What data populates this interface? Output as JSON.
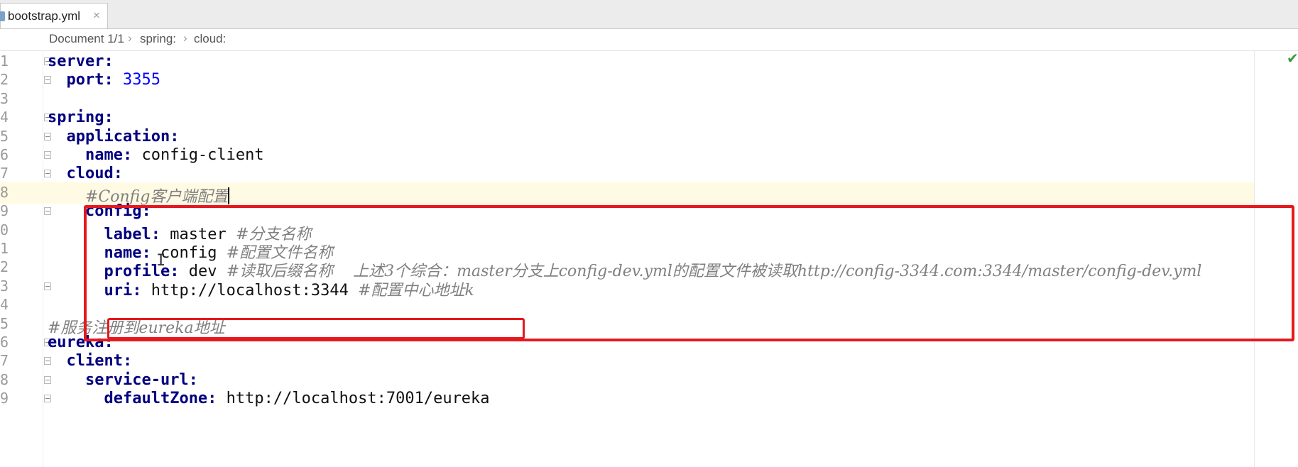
{
  "tab": {
    "label": "bootstrap.yml",
    "close": "×"
  },
  "breadcrumb": {
    "items": [
      "Document 1/1",
      "spring:",
      "cloud:"
    ],
    "separator": "›"
  },
  "status_check": "✔",
  "lines": [
    {
      "num": "1",
      "parts": [
        {
          "t": "key",
          "v": "server:"
        }
      ]
    },
    {
      "num": "2",
      "parts": [
        {
          "t": "ws",
          "v": "  "
        },
        {
          "t": "key",
          "v": "port:"
        },
        {
          "t": "val",
          "v": " "
        },
        {
          "t": "num",
          "v": "3355"
        }
      ]
    },
    {
      "num": "3",
      "parts": []
    },
    {
      "num": "4",
      "parts": [
        {
          "t": "key",
          "v": "spring:"
        }
      ]
    },
    {
      "num": "5",
      "parts": [
        {
          "t": "ws",
          "v": "  "
        },
        {
          "t": "key",
          "v": "application:"
        }
      ]
    },
    {
      "num": "6",
      "parts": [
        {
          "t": "ws",
          "v": "    "
        },
        {
          "t": "key",
          "v": "name:"
        },
        {
          "t": "val",
          "v": " config-client"
        }
      ]
    },
    {
      "num": "7",
      "parts": [
        {
          "t": "ws",
          "v": "  "
        },
        {
          "t": "key",
          "v": "cloud:"
        }
      ]
    },
    {
      "num": "8",
      "parts": [
        {
          "t": "ws",
          "v": "    "
        },
        {
          "t": "cmt",
          "v": "#Config客户端配置"
        }
      ]
    },
    {
      "num": "9",
      "parts": [
        {
          "t": "ws",
          "v": "    "
        },
        {
          "t": "key",
          "v": "config:"
        }
      ]
    },
    {
      "num": "0",
      "parts": [
        {
          "t": "ws",
          "v": "      "
        },
        {
          "t": "key",
          "v": "label:"
        },
        {
          "t": "val",
          "v": " master "
        },
        {
          "t": "cmt",
          "v": "#分支名称"
        }
      ]
    },
    {
      "num": "1",
      "parts": [
        {
          "t": "ws",
          "v": "      "
        },
        {
          "t": "key",
          "v": "name:"
        },
        {
          "t": "val",
          "v": " config "
        },
        {
          "t": "cmt",
          "v": "#配置文件名称"
        }
      ]
    },
    {
      "num": "2",
      "parts": [
        {
          "t": "ws",
          "v": "      "
        },
        {
          "t": "key",
          "v": "profile:"
        },
        {
          "t": "val",
          "v": " dev "
        },
        {
          "t": "cmt",
          "v": "#读取后缀名称    上述3个综合：master分支上config-dev.yml的配置文件被读取http://config-3344.com:3344/master/config-dev.yml"
        }
      ]
    },
    {
      "num": "3",
      "parts": [
        {
          "t": "ws",
          "v": "      "
        },
        {
          "t": "key",
          "v": "uri:"
        },
        {
          "t": "val",
          "v": " http://localhost:3344 "
        },
        {
          "t": "cmt",
          "v": "#配置中心地址k"
        }
      ]
    },
    {
      "num": "4",
      "parts": []
    },
    {
      "num": "5",
      "parts": [
        {
          "t": "cmt",
          "v": "#服务注册到eureka地址"
        }
      ]
    },
    {
      "num": "6",
      "parts": [
        {
          "t": "key",
          "v": "eureka:"
        }
      ]
    },
    {
      "num": "7",
      "parts": [
        {
          "t": "ws",
          "v": "  "
        },
        {
          "t": "key",
          "v": "client:"
        }
      ]
    },
    {
      "num": "8",
      "parts": [
        {
          "t": "ws",
          "v": "    "
        },
        {
          "t": "key",
          "v": "service-url:"
        }
      ]
    },
    {
      "num": "9",
      "parts": [
        {
          "t": "ws",
          "v": "      "
        },
        {
          "t": "key",
          "v": "defaultZone:"
        },
        {
          "t": "val",
          "v": " http://localhost:7001/eureka"
        }
      ]
    }
  ],
  "current_line": 7,
  "folded_lines": [
    1,
    2,
    4,
    5,
    6,
    7,
    9,
    13,
    16,
    17,
    18,
    19
  ],
  "colors": {
    "key": "#000080",
    "number": "#0000ff",
    "comment": "#808080",
    "highlight": "#e5191d",
    "current_line_bg": "#fffae3"
  }
}
